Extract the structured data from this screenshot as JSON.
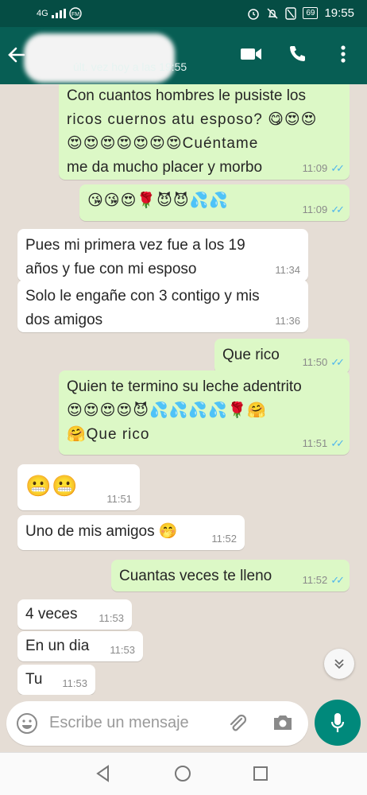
{
  "status_bar": {
    "left_text": "4G",
    "battery": "69",
    "time": "19:55"
  },
  "header": {
    "contact_name": "",
    "last_seen": "últ. vez hoy a las 19:55",
    "icons": [
      "back-arrow-icon",
      "video-call-icon",
      "phone-icon",
      "more-vert-icon"
    ]
  },
  "messages": [
    {
      "direction": "out",
      "lines": [
        "Con cuantos hombres le pusiste los",
        "ricos cuernos atu esposo? 😋😍😍",
        "😍😍😍😍😍😍😍Cuéntame",
        "me da mucho placer y morbo"
      ],
      "time": "11:09",
      "ticks": "✓✓"
    },
    {
      "direction": "out",
      "lines": [
        "😘😘😍🌹😈😈💦💦"
      ],
      "time": "11:09",
      "ticks": "✓✓"
    },
    {
      "direction": "in",
      "lines": [
        "Pues mi primera vez fue a los 19",
        "años y fue con mi esposo"
      ],
      "time": "11:34"
    },
    {
      "direction": "in",
      "lines": [
        "Solo le engañe con 3 contigo y mis",
        "dos amigos"
      ],
      "time": "11:36"
    },
    {
      "direction": "out",
      "lines": [
        "Que rico"
      ],
      "time": "11:50",
      "ticks": "✓✓"
    },
    {
      "direction": "out",
      "lines": [
        "Quien te termino su leche adentrito",
        "😍😍😍😍😈💦💦💦💦🌹🤗",
        "🤗Que rico"
      ],
      "time": "11:51",
      "ticks": "✓✓"
    },
    {
      "direction": "in",
      "lines": [
        "😬😬"
      ],
      "time": "11:51"
    },
    {
      "direction": "in",
      "lines": [
        "Uno de mis amigos 🤭"
      ],
      "time": "11:52"
    },
    {
      "direction": "out",
      "lines": [
        "Cuantas veces te lleno"
      ],
      "time": "11:52",
      "ticks": "✓✓"
    },
    {
      "direction": "in",
      "lines": [
        "4 veces"
      ],
      "time": "11:53"
    },
    {
      "direction": "in",
      "lines": [
        "En un dia"
      ],
      "time": "11:53"
    },
    {
      "direction": "in",
      "lines": [
        "Tu"
      ],
      "time": "11:53"
    }
  ],
  "composer": {
    "placeholder": "Escribe un mensaje"
  },
  "colors": {
    "header": "#075e54",
    "outgoing_bubble": "#dcf8c6",
    "incoming_bubble": "#ffffff",
    "read_ticks": "#4fb6ec",
    "mic_button": "#00897b"
  }
}
